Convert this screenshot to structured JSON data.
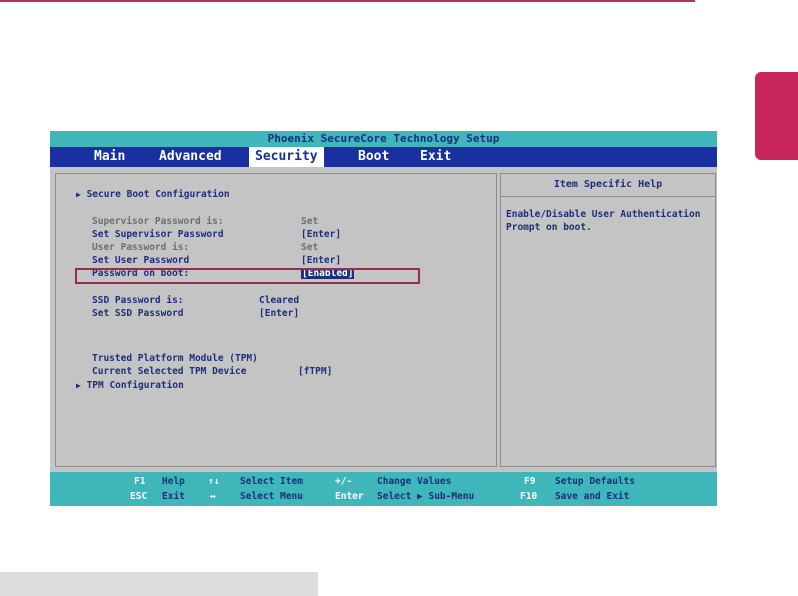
{
  "bios": {
    "title": "Phoenix SecureCore Technology Setup",
    "tabs": [
      {
        "label": "Main"
      },
      {
        "label": "Advanced"
      },
      {
        "label": "Security"
      },
      {
        "label": "Boot"
      },
      {
        "label": "Exit"
      }
    ],
    "active_tab": "Security",
    "items": {
      "secure_boot": "Secure Boot Configuration",
      "supervisor_label": "Supervisor Password is:",
      "supervisor_value": "Set",
      "set_supervisor_label": "Set Supervisor Password",
      "set_supervisor_value": "[Enter]",
      "user_label": "User Password is:",
      "user_value": "Set",
      "set_user_label": "Set User Password",
      "set_user_value": "[Enter]",
      "pwd_boot_label": "Password on boot:",
      "pwd_boot_value": "[Enabled]",
      "ssd_label": "SSD Password is:",
      "ssd_value": "Cleared",
      "set_ssd_label": "Set SSD Password",
      "set_ssd_value": "[Enter]",
      "tpm_label": "Trusted Platform Module (TPM)",
      "tpm_device_label": "Current Selected TPM Device",
      "tpm_device_value": "[fTPM]",
      "tpm_config": "TPM Configuration"
    },
    "help": {
      "title": "Item Specific Help",
      "text": "Enable/Disable User Authentication Prompt on boot."
    },
    "footer": {
      "f1_key": "F1",
      "f1_desc": "Help",
      "updown_key": "↑↓",
      "updown_desc": "Select Item",
      "plusminus_key": "+/-",
      "plusminus_desc": "Change Values",
      "f9_key": "F9",
      "f9_desc": "Setup Defaults",
      "esc_key": "ESC",
      "esc_desc": "Exit",
      "leftright_key": "↔",
      "leftright_desc": "Select Menu",
      "enter_key": "Enter",
      "enter_desc": "Select ▶ Sub-Menu",
      "f10_key": "F10",
      "f10_desc": "Save and Exit"
    },
    "colors": {
      "menubar": "#1930a0",
      "titlebar": "#3eb6ba",
      "panel": "#c4c4c4",
      "highlight_border": "#9b2b4a"
    }
  },
  "decor": {
    "accent": "#c8255c"
  }
}
